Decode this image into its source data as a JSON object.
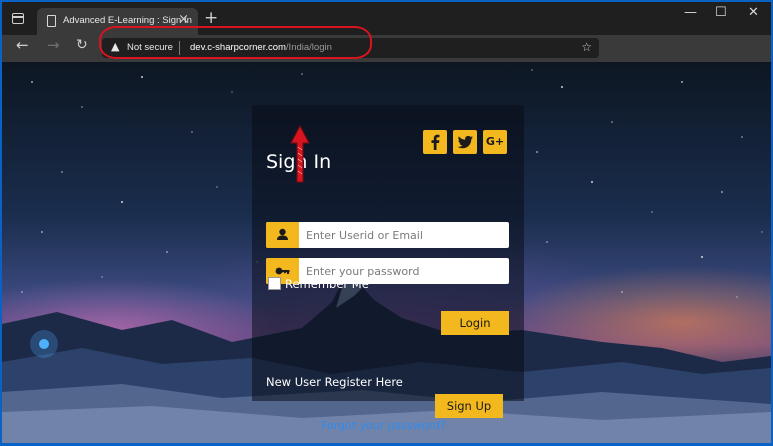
{
  "browser": {
    "tab_title": "Advanced E-Learning : Sign In",
    "tab_close": "×",
    "new_tab": "+",
    "window_controls": {
      "minimize": "—",
      "maximize": "☐",
      "close": "✕"
    },
    "nav": {
      "back": "←",
      "forward": "→",
      "refresh": "↻"
    },
    "address": {
      "security_label": "Not secure",
      "url_host": "dev.c-sharpcorner.com",
      "url_path": "/India/login"
    }
  },
  "login": {
    "title": "Sign In",
    "social": [
      "facebook-icon",
      "twitter-icon",
      "google-plus-icon"
    ],
    "google_plus_text": "G+",
    "userid_placeholder": "Enter Userid or Email",
    "password_placeholder": "Enter your password",
    "remember_label": "Remember Me",
    "login_button": "Login",
    "register_text": "New User Register Here",
    "signup_button": "Sign Up",
    "forgot_link": "Forgot your password?"
  },
  "colors": {
    "accent": "#f2b81d",
    "annotation": "#d8141e",
    "link": "#2d8cf0"
  }
}
